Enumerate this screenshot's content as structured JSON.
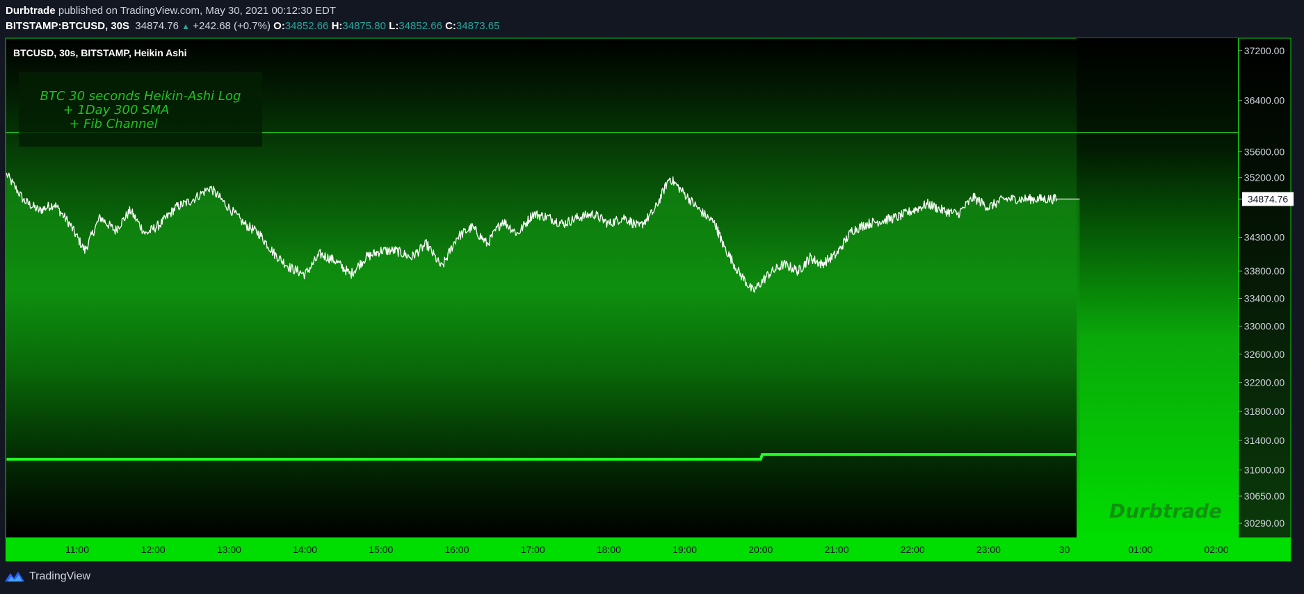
{
  "header": {
    "author": "Durbtrade",
    "published_text": "published on TradingView.com, May 30, 2021 00:12:30 EDT",
    "symbol": "BITSTAMP:BTCUSD, 30S",
    "last": "34874.76",
    "change": "+242.68 (+0.7%)",
    "o_label": "O:",
    "o_value": "34852.66",
    "h_label": "H:",
    "h_value": "34875.80",
    "l_label": "L:",
    "l_value": "34852.66",
    "c_label": "C:",
    "c_value": "34873.65"
  },
  "chart_title": "BTCUSD, 30s, BITSTAMP, Heikin Ashi",
  "annotation": [
    "BTC 30 seconds Heikin-Ashi Log",
    "+ 1Day 300 SMA",
    "+ Fib Channel"
  ],
  "watermark": "Durbtrade",
  "brand": "TradingView",
  "colors": {
    "accent_green": "#00ff00",
    "label_green": "#22c022",
    "price_line": "#ffffff",
    "background": "#131722",
    "up": "#26a69a"
  },
  "chart_data": {
    "type": "line",
    "title": "BTCUSD, 30s, BITSTAMP, Heikin Ashi",
    "scale": "log",
    "ylim": [
      30100,
      37400
    ],
    "y_ticks": [
      "37200.00",
      "36400.00",
      "35600.00",
      "35200.00",
      "34300.00",
      "33800.00",
      "33400.00",
      "33000.00",
      "32600.00",
      "32200.00",
      "31800.00",
      "31400.00",
      "31000.00",
      "30650.00",
      "30290.00"
    ],
    "x_ticks": [
      "11:00",
      "12:00",
      "13:00",
      "14:00",
      "15:00",
      "16:00",
      "17:00",
      "18:00",
      "19:00",
      "20:00",
      "21:00",
      "22:00",
      "23:00",
      "30",
      "01:00",
      "02:00"
    ],
    "last_price_label": "34874.76",
    "fib_line_price": 35900,
    "series": [
      {
        "values_x_hours": [
          10.07,
          10.3,
          10.5,
          10.7,
          10.9,
          11.1,
          11.3,
          11.5,
          11.7,
          11.9,
          12.1,
          12.3,
          12.5,
          12.75,
          12.95,
          13.2,
          13.4,
          13.6,
          13.8,
          14.0,
          14.2,
          14.4,
          14.6,
          14.8,
          15.0,
          15.2,
          15.4,
          15.6,
          15.8,
          16.0,
          16.2,
          16.4,
          16.6,
          16.8,
          17.0,
          17.2,
          17.4,
          17.6,
          17.8,
          18.0,
          18.2,
          18.4,
          18.6,
          18.8,
          19.0,
          19.2,
          19.4,
          19.5,
          19.7,
          19.9,
          20.1,
          20.3,
          20.5,
          20.65,
          20.8,
          21.0,
          21.2,
          21.4,
          21.6,
          21.8,
          22.0,
          22.2,
          22.4,
          22.6,
          22.8,
          23.0,
          23.2,
          23.4,
          23.6,
          23.8,
          24.0,
          24.2
        ],
        "values": [
          35250,
          34850,
          34700,
          34800,
          34500,
          34100,
          34600,
          34400,
          34700,
          34350,
          34500,
          34750,
          34850,
          35050,
          34800,
          34500,
          34350,
          34050,
          33850,
          33750,
          34050,
          33950,
          33750,
          34000,
          34100,
          34100,
          34000,
          34200,
          33850,
          34300,
          34450,
          34200,
          34550,
          34350,
          34650,
          34600,
          34500,
          34600,
          34650,
          34500,
          34600,
          34450,
          34700,
          35200,
          34950,
          34700,
          34500,
          34200,
          33800,
          33500,
          33750,
          33900,
          33800,
          34000,
          33900,
          34050,
          34400,
          34500,
          34550,
          34600,
          34700,
          34800,
          34700,
          34650,
          34900,
          34750,
          34874.76,
          34875,
          34874.76,
          34874.76,
          34874.76,
          34874.76
        ]
      },
      {
        "name": "1Day 300 SMA",
        "values_x_hours": [
          10.07,
          20.0,
          20.02,
          24.15
        ],
        "values": [
          31145,
          31145,
          31210,
          31210
        ]
      }
    ]
  }
}
